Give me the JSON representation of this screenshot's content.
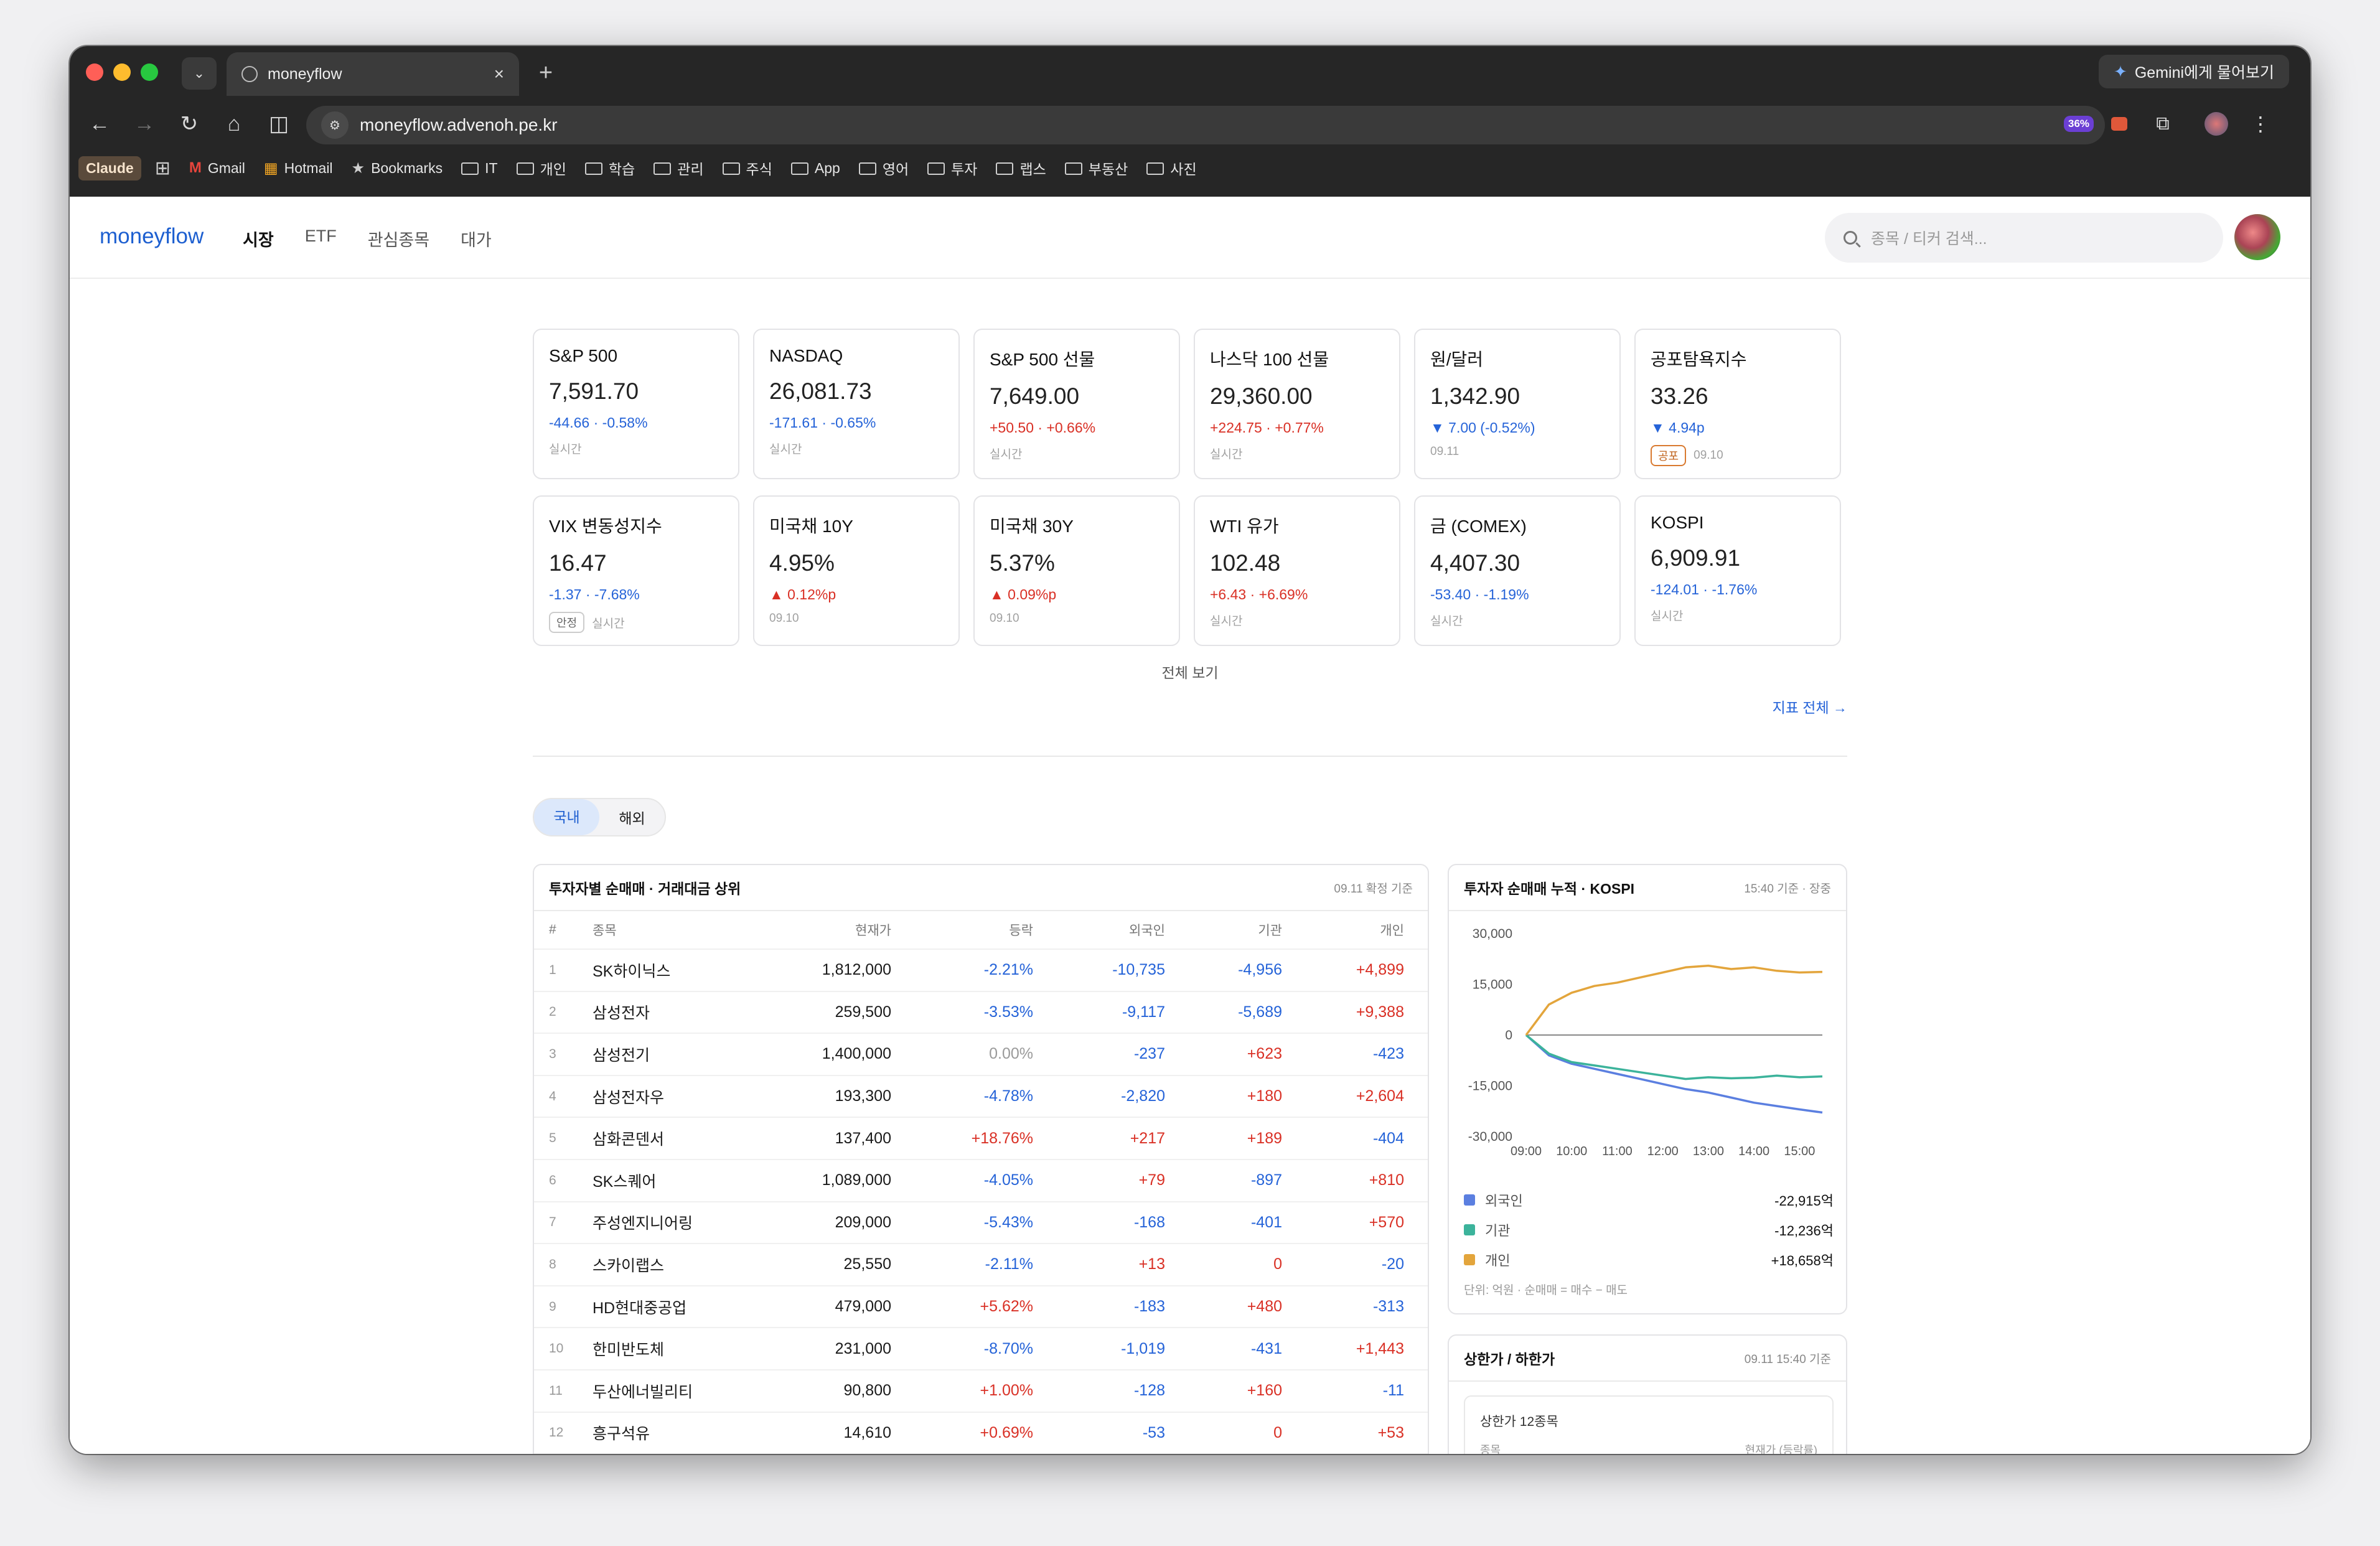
{
  "browser": {
    "tab_title": "moneyflow",
    "url": "moneyflow.advenoh.pe.kr",
    "gemini_label": "Gemini에게 물어보기",
    "extension_badge": "36%",
    "bookmarks": [
      {
        "label": "Claude",
        "type": "app"
      },
      {
        "label": "Gmail",
        "type": "gmail"
      },
      {
        "label": "Hotmail",
        "type": "hotmail"
      },
      {
        "label": "Bookmarks",
        "type": "star"
      },
      {
        "label": "IT",
        "type": "folder"
      },
      {
        "label": "개인",
        "type": "folder"
      },
      {
        "label": "학습",
        "type": "folder"
      },
      {
        "label": "관리",
        "type": "folder"
      },
      {
        "label": "주식",
        "type": "folder"
      },
      {
        "label": "App",
        "type": "folder"
      },
      {
        "label": "영어",
        "type": "folder"
      },
      {
        "label": "투자",
        "type": "folder"
      },
      {
        "label": "랩스",
        "type": "folder"
      },
      {
        "label": "부동산",
        "type": "folder"
      },
      {
        "label": "사진",
        "type": "folder"
      }
    ]
  },
  "app": {
    "logo": "moneyflow",
    "nav": [
      "시장",
      "ETF",
      "관심종목",
      "대가"
    ],
    "nav_active": 0,
    "search_placeholder": "종목 / 티커 검색..."
  },
  "indices": [
    {
      "name": "S&P 500",
      "value": "7,591.70",
      "change": "-44.66 · -0.58%",
      "dir": "down",
      "meta": "실시간"
    },
    {
      "name": "NASDAQ",
      "value": "26,081.73",
      "change": "-171.61 · -0.65%",
      "dir": "down",
      "meta": "실시간"
    },
    {
      "name": "S&P 500 선물",
      "value": "7,649.00",
      "change": "+50.50 · +0.66%",
      "dir": "up",
      "meta": "실시간"
    },
    {
      "name": "나스닥 100 선물",
      "value": "29,360.00",
      "change": "+224.75 · +0.77%",
      "dir": "up",
      "meta": "실시간"
    },
    {
      "name": "원/달러",
      "value": "1,342.90",
      "change": "▼ 7.00 (-0.52%)",
      "dir": "down",
      "meta": "09.11"
    },
    {
      "name": "공포탐욕지수",
      "value": "33.26",
      "change": "▼ 4.94p",
      "dir": "down",
      "meta": "09.10",
      "badge": "공포"
    },
    {
      "name": "VIX 변동성지수",
      "value": "16.47",
      "change": "-1.37 · -7.68%",
      "dir": "down",
      "meta": "실시간",
      "badge": "안정"
    },
    {
      "name": "미국채 10Y",
      "value": "4.95%",
      "change": "▲ 0.12%p",
      "dir": "up",
      "meta": "09.10"
    },
    {
      "name": "미국채 30Y",
      "value": "5.37%",
      "change": "▲ 0.09%p",
      "dir": "up",
      "meta": "09.10"
    },
    {
      "name": "WTI 유가",
      "value": "102.48",
      "change": "+6.43 · +6.69%",
      "dir": "up",
      "meta": "실시간"
    },
    {
      "name": "금 (COMEX)",
      "value": "4,407.30",
      "change": "-53.40 · -1.19%",
      "dir": "down",
      "meta": "실시간"
    },
    {
      "name": "KOSPI",
      "value": "6,909.91",
      "change": "-124.01 · -1.76%",
      "dir": "down",
      "meta": "실시간"
    }
  ],
  "view_all": "전체 보기",
  "indicators_all": "지표 전체 →",
  "segment": [
    "국내",
    "해외"
  ],
  "segment_active": 0,
  "table": {
    "title": "투자자별 순매매 · 거래대금 상위",
    "asof": "09.11 확정 기준",
    "headers": [
      "#",
      "종목",
      "현재가",
      "등락",
      "외국인",
      "기관",
      "개인"
    ],
    "rows": [
      [
        "1",
        "SK하이닉스",
        "1,812,000",
        "-2.21%",
        "-10,735",
        "-4,956",
        "+4,899"
      ],
      [
        "2",
        "삼성전자",
        "259,500",
        "-3.53%",
        "-9,117",
        "-5,689",
        "+9,388"
      ],
      [
        "3",
        "삼성전기",
        "1,400,000",
        "0.00%",
        "-237",
        "+623",
        "-423"
      ],
      [
        "4",
        "삼성전자우",
        "193,300",
        "-4.78%",
        "-2,820",
        "+180",
        "+2,604"
      ],
      [
        "5",
        "삼화콘덴서",
        "137,400",
        "+18.76%",
        "+217",
        "+189",
        "-404"
      ],
      [
        "6",
        "SK스퀘어",
        "1,089,000",
        "-4.05%",
        "+79",
        "-897",
        "+810"
      ],
      [
        "7",
        "주성엔지니어링",
        "209,000",
        "-5.43%",
        "-168",
        "-401",
        "+570"
      ],
      [
        "8",
        "스카이랩스",
        "25,550",
        "-2.11%",
        "+13",
        "0",
        "-20"
      ],
      [
        "9",
        "HD현대중공업",
        "479,000",
        "+5.62%",
        "-183",
        "+480",
        "-313"
      ],
      [
        "10",
        "한미반도체",
        "231,000",
        "-8.70%",
        "-1,019",
        "-431",
        "+1,443"
      ],
      [
        "11",
        "두산에너빌리티",
        "90,800",
        "+1.00%",
        "-128",
        "+160",
        "-11"
      ],
      [
        "12",
        "흥구석유",
        "14,610",
        "+0.69%",
        "-53",
        "0",
        "+53"
      ]
    ]
  },
  "flow_chart": {
    "title": "투자자 순매매 누적 · KOSPI",
    "asof": "15:40 기준 · 장중",
    "unit_note": "단위: 억원 · 순매매 = 매수 − 매도",
    "legend": [
      {
        "name": "외국인",
        "value": "-22,915억",
        "color": "#5b7fe0"
      },
      {
        "name": "기관",
        "value": "-12,236억",
        "color": "#3cb39b"
      },
      {
        "name": "개인",
        "value": "+18,658억",
        "color": "#e3a53c"
      }
    ]
  },
  "chart_data": {
    "type": "line",
    "title": "투자자 순매매 누적 · KOSPI",
    "x": [
      "09:00",
      "09:30",
      "10:00",
      "10:30",
      "11:00",
      "11:30",
      "12:00",
      "12:30",
      "13:00",
      "13:30",
      "14:00",
      "14:30",
      "15:00",
      "15:30"
    ],
    "x_ticks": [
      "09:00",
      "10:00",
      "11:00",
      "12:00",
      "13:00",
      "14:00",
      "15:00"
    ],
    "y_ticks": [
      "30,000",
      "15,000",
      "0",
      "-15,000",
      "-30,000"
    ],
    "ylim": [
      -30000,
      30000
    ],
    "series": [
      {
        "name": "외국인",
        "color": "#5b7fe0",
        "values": [
          0,
          -6000,
          -8500,
          -10000,
          -11500,
          -13000,
          -14500,
          -16000,
          -17000,
          -18500,
          -20000,
          -21000,
          -22000,
          -22915
        ]
      },
      {
        "name": "기관",
        "color": "#3cb39b",
        "values": [
          0,
          -5500,
          -8000,
          -9000,
          -10000,
          -11000,
          -12000,
          -13000,
          -12500,
          -12800,
          -12600,
          -12000,
          -12500,
          -12236
        ]
      },
      {
        "name": "개인",
        "color": "#e3a53c",
        "values": [
          0,
          9000,
          12500,
          14500,
          15500,
          17000,
          18500,
          20000,
          20500,
          19500,
          20000,
          19000,
          18500,
          18658
        ]
      }
    ]
  },
  "limits": {
    "title": "상한가 / 하한가",
    "asof": "09.11 15:40 기준",
    "upper_count": "상한가 12종목",
    "col_name": "종목",
    "col_price": "현재가 (등락률)"
  }
}
